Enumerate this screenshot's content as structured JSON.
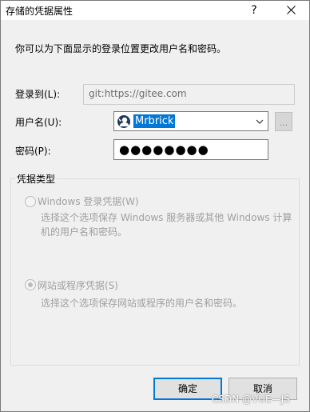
{
  "window": {
    "title": "存储的凭据属性",
    "help_glyph": "?",
    "close_glyph": "✕"
  },
  "intro_text": "你可以为下面显示的登录位置更改用户名和密码。",
  "fields": {
    "login_label": "登录到(L):",
    "login_value": "git:https://gitee.com",
    "username_label": "用户名(U):",
    "username_value": "Mrbrick",
    "browse_label": "...",
    "password_label": "密码(P):",
    "password_mask": "●●●●●●●●"
  },
  "credential_type": {
    "title": "凭据类型",
    "options": [
      {
        "label": "Windows 登录凭据(W)",
        "checked": false,
        "description": "选择这个选项保存 Windows 服务器或其他 Windows 计算机的用户名和密码。"
      },
      {
        "label": "网站或程序凭据(S)",
        "checked": true,
        "description": "选择这个选项保存网站或程序的用户名和密码。"
      }
    ]
  },
  "buttons": {
    "ok": "确定",
    "cancel": "取消"
  },
  "watermark": "CSDN @VUE—JS",
  "colors": {
    "accent": "#0078d7",
    "dialog_bg": "#f0f0f0",
    "disabled_text": "#a0a0a0"
  }
}
